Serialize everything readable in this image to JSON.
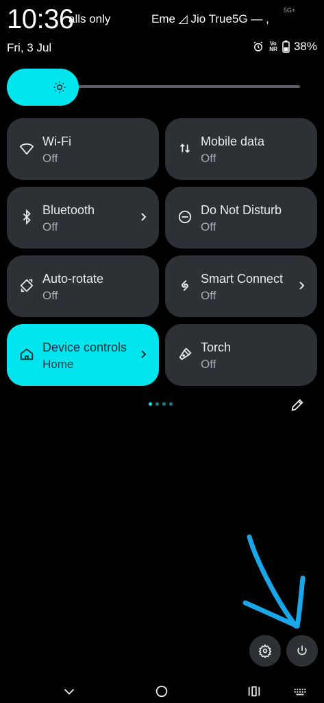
{
  "status_bar": {
    "time": "10:36",
    "calls_only": "alls only",
    "carrier": "Eme ◿ Jio True5G — ,",
    "signal_label": "5G+",
    "date": "Fri, 3 Jul",
    "volte_label": "Vo NR",
    "battery": "38%"
  },
  "brightness": {
    "level_percent": 20,
    "icon": "brightness-icon"
  },
  "tiles": [
    {
      "title": "Wi-Fi",
      "sub": "Off",
      "icon": "wifi-icon",
      "active": false
    },
    {
      "title": "Mobile data",
      "sub": "Off",
      "icon": "mobile-data-icon",
      "active": false
    },
    {
      "title": "Bluetooth",
      "sub": "Off",
      "icon": "bluetooth-icon",
      "active": false
    },
    {
      "title": "Do Not Disturb",
      "sub": "Off",
      "icon": "dnd-icon",
      "active": false
    },
    {
      "title": "Auto-rotate",
      "sub": "Off",
      "icon": "auto-rotate-icon",
      "active": false
    },
    {
      "title": "Smart Connect",
      "sub": "Off",
      "icon": "smart-connect-icon",
      "active": false
    },
    {
      "title": "Device controls",
      "sub": "Home",
      "icon": "home-icon",
      "active": true
    },
    {
      "title": "Torch",
      "sub": "Off",
      "icon": "torch-icon",
      "active": false
    }
  ],
  "pager": {
    "pages": 4,
    "current": 1
  },
  "colors": {
    "accent": "#00e5ee",
    "tile_bg": "#2d3034",
    "annotation_arrow": "#1aa7e8"
  }
}
